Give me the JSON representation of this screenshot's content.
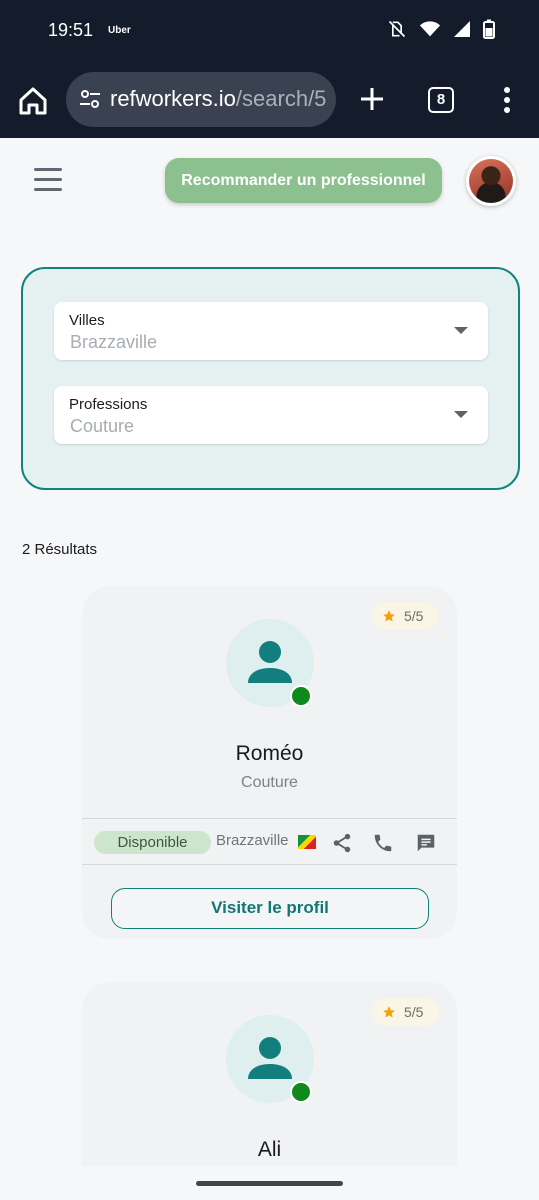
{
  "status_bar": {
    "time": "19:51",
    "carrier": "Uber",
    "icons": [
      "vibrate-off-icon",
      "wifi-icon",
      "signal-icon",
      "battery-icon"
    ]
  },
  "browser": {
    "url_host": "refworkers.io",
    "url_path": "/search/5",
    "tab_count": "8"
  },
  "header": {
    "recommend_label": "Recommander un professionnel"
  },
  "filters": {
    "city_label": "Villes",
    "city_value": "Brazzaville",
    "profession_label": "Professions",
    "profession_value": "Couture"
  },
  "results": {
    "count_text": "2 Résultats",
    "items": [
      {
        "rating": "5/5",
        "name": "Roméo",
        "profession": "Couture",
        "availability": "Disponible",
        "city": "Brazzaville",
        "visit_label": "Visiter le profil"
      },
      {
        "rating": "5/5",
        "name": "Ali"
      }
    ]
  },
  "colors": {
    "accent": "#11837d",
    "recommend_button": "#8cc08f",
    "online": "#0d8a1b",
    "available_badge": "#cde5cc"
  }
}
